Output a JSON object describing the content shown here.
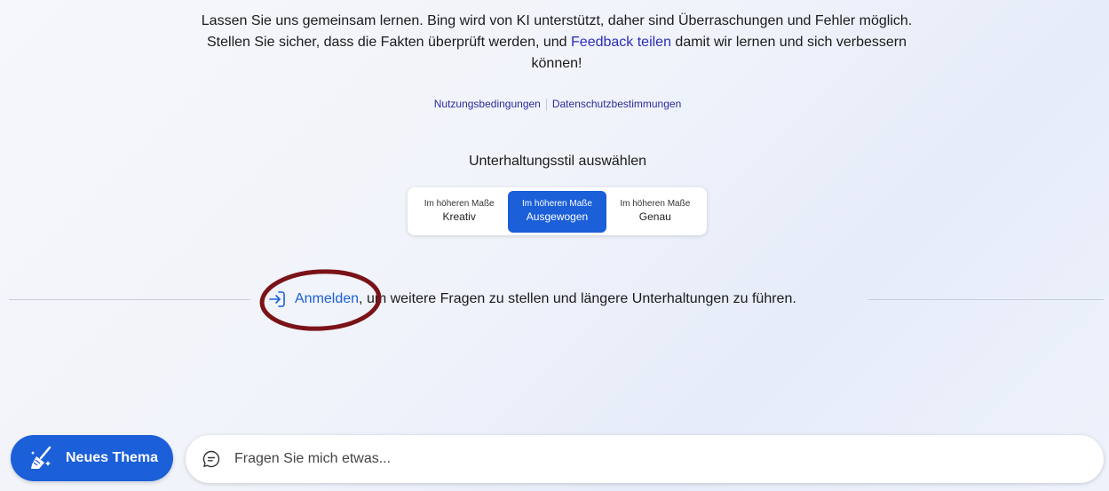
{
  "disclaimer": {
    "text_before": "Lassen Sie uns gemeinsam lernen. Bing wird von KI unterstützt, daher sind Überraschungen und Fehler möglich. Stellen Sie sicher, dass die Fakten überprüft werden, und ",
    "feedback_link": "Feedback teilen",
    "text_after": " damit wir lernen und sich verbessern können!"
  },
  "legal": {
    "terms": "Nutzungsbedingungen",
    "privacy": "Datenschutzbestimmungen"
  },
  "style_picker": {
    "title": "Unterhaltungsstil auswählen",
    "options": [
      {
        "prefix": "Im höheren Maße",
        "label": "Kreativ"
      },
      {
        "prefix": "Im höheren Maße",
        "label": "Ausgewogen"
      },
      {
        "prefix": "Im höheren Maße",
        "label": "Genau"
      }
    ],
    "selected": "Ausgewogen"
  },
  "signin": {
    "link": "Anmelden",
    "text": ", um weitere Fragen zu stellen und längere Unterhaltungen zu führen.",
    "icon": "sign-in-icon"
  },
  "composer": {
    "new_topic_label": "Neues Thema",
    "new_topic_icon": "broom-icon",
    "placeholder": "Fragen Sie mich etwas...",
    "chat_icon": "chat-bubble-icon"
  },
  "colors": {
    "accent": "#1b5fd9",
    "link": "#2b2bb8",
    "annotation": "#7a1318"
  }
}
